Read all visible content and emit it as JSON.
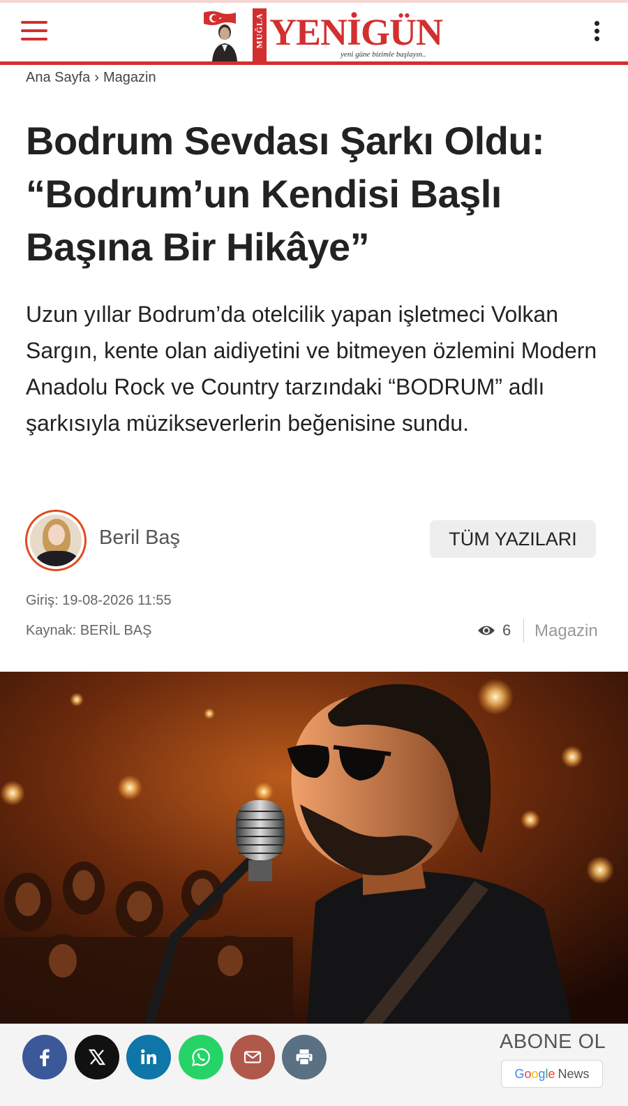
{
  "header": {
    "logo_text": "YENİGÜN",
    "logo_side_text": "MUĞLA",
    "logo_slogan": "yeni güne bizimle başlayın..",
    "accent_color": "#d32f2f",
    "menu_icon": "hamburger-menu-icon",
    "more_icon": "vertical-dots-icon"
  },
  "breadcrumb": {
    "home": "Ana Sayfa",
    "separator": "›",
    "category": "Magazin"
  },
  "article": {
    "title": "Bodrum Sevdası Şarkı Oldu: “Bodrum’un Kendisi Başlı Başına Bir Hikâye”",
    "lead": "Uzun yıllar Bodrum’da otelcilik yapan işletmeci Volkan Sargın, kente olan aidiyetini ve bitmeyen özlemini Modern Anadolu Rock ve Country tarzındaki “BODRUM” adlı şarkısıyla müzikseverlerin beğenisine sundu."
  },
  "author": {
    "name": "Beril Baş",
    "all_posts_label": "TÜM YAZILARI"
  },
  "meta": {
    "date": "Giriş: 19-08-2026 11:55",
    "source": "Kaynak: BERİL BAŞ",
    "views": "6",
    "category": "Magazin"
  },
  "share": {
    "facebook_color": "#3b5998",
    "x_color": "#111111",
    "linkedin_color": "#0e76a8",
    "whatsapp_color": "#25d366",
    "email_color": "#b0584a",
    "print_color": "#5a7083",
    "subscribe_label": "ABONE OL",
    "google_news": {
      "google": [
        "G",
        "o",
        "o",
        "g",
        "l",
        "e"
      ],
      "news": "News"
    }
  }
}
